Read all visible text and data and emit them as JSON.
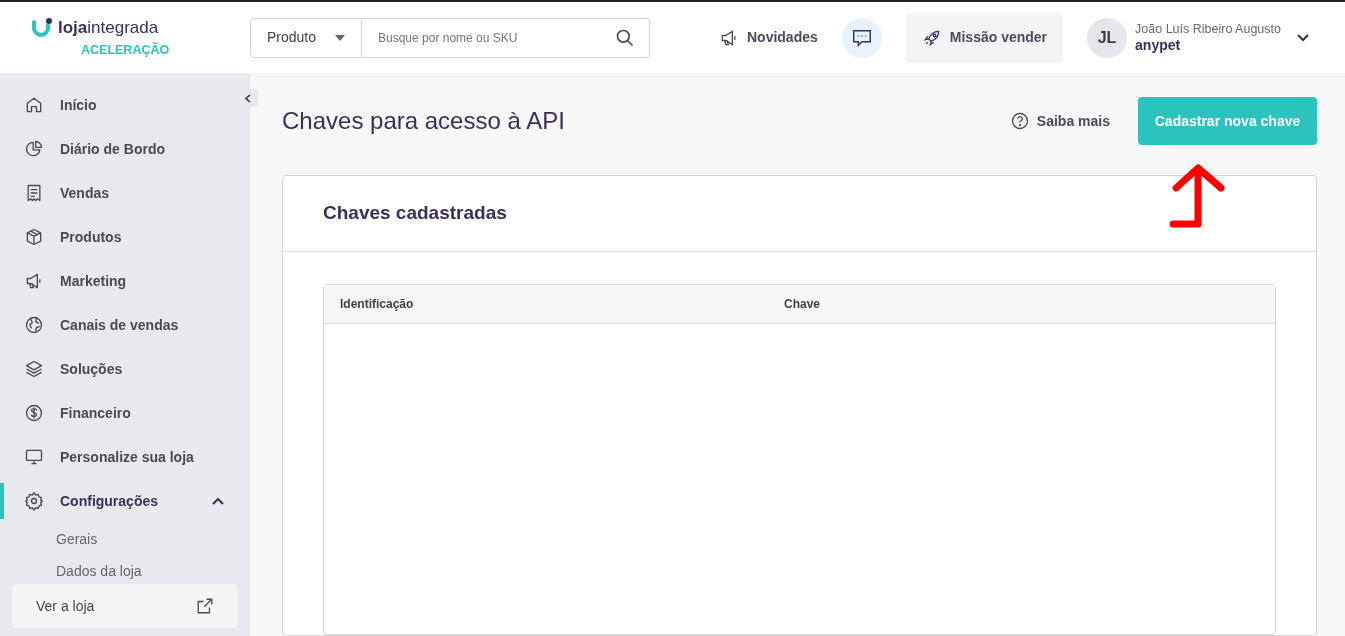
{
  "header": {
    "logo": {
      "wordmark_bold": "loja",
      "wordmark": "integrada",
      "plan": "ACELERAÇÃO"
    },
    "search": {
      "scope": "Produto",
      "placeholder": "Busque por nome ou SKU"
    },
    "news": "Novidades",
    "mission": "Missão vender",
    "user": {
      "initials": "JL",
      "name": "João Luís Ribeiro Augusto",
      "store": "anypet"
    }
  },
  "sidebar": {
    "items": [
      {
        "label": "Início",
        "selected": false
      },
      {
        "label": "Diário de Bordo",
        "selected": false
      },
      {
        "label": "Vendas",
        "selected": false
      },
      {
        "label": "Produtos",
        "selected": false
      },
      {
        "label": "Marketing",
        "selected": false
      },
      {
        "label": "Canais de vendas",
        "selected": false
      },
      {
        "label": "Soluções",
        "selected": false
      },
      {
        "label": "Financeiro",
        "selected": false
      },
      {
        "label": "Personalize sua loja",
        "selected": false
      },
      {
        "label": "Configurações",
        "selected": true,
        "expanded": true,
        "children": [
          {
            "label": "Gerais"
          },
          {
            "label": "Dados da loja"
          }
        ]
      }
    ],
    "footer_link": "Ver a loja"
  },
  "page": {
    "title": "Chaves para acesso à API",
    "help": "Saiba mais",
    "primary_button": "Cadastrar nova chave",
    "card": {
      "title": "Chaves cadastradas",
      "table": {
        "columns": [
          "Identificação",
          "Chave"
        ]
      }
    }
  }
}
